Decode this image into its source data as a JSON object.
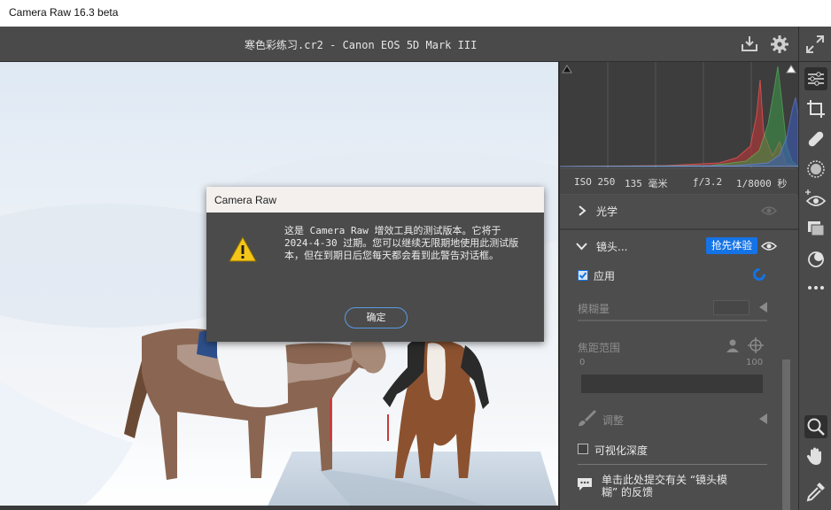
{
  "window": {
    "title": "Camera Raw 16.3 beta"
  },
  "file": {
    "name": "寒色彩练习.cr2 -  Canon EOS 5D Mark III"
  },
  "exif": {
    "iso": "ISO 250",
    "focal": "135 毫米",
    "aperture": "ƒ/3.2",
    "shutter": "1/8000 秒"
  },
  "panels": {
    "optics": {
      "label": "光学"
    },
    "lens_blur": {
      "label": "镜头...",
      "badge": "抢先体验",
      "apply_label": "应用",
      "amount_label": "模糊量",
      "focal_range_label": "焦距范围",
      "range_min": "0",
      "range_max": "100",
      "adjust_label": "调整",
      "visualize_depth_label": "可视化深度",
      "feedback_text": "单击此处提交有关 “镜头模糊” 的反馈"
    }
  },
  "dialog": {
    "title": "Camera Raw",
    "message": "这是 Camera Raw 增效工具的测试版本。它将于 2024-4-30 过期。您可以继续无限期地使用此测试版本，但在到期日后您每天都会看到此警告对话框。",
    "ok_label": "确定"
  },
  "colors": {
    "accent": "#1473e6",
    "panel": "#535353",
    "dialog": "#4b4b4b"
  }
}
